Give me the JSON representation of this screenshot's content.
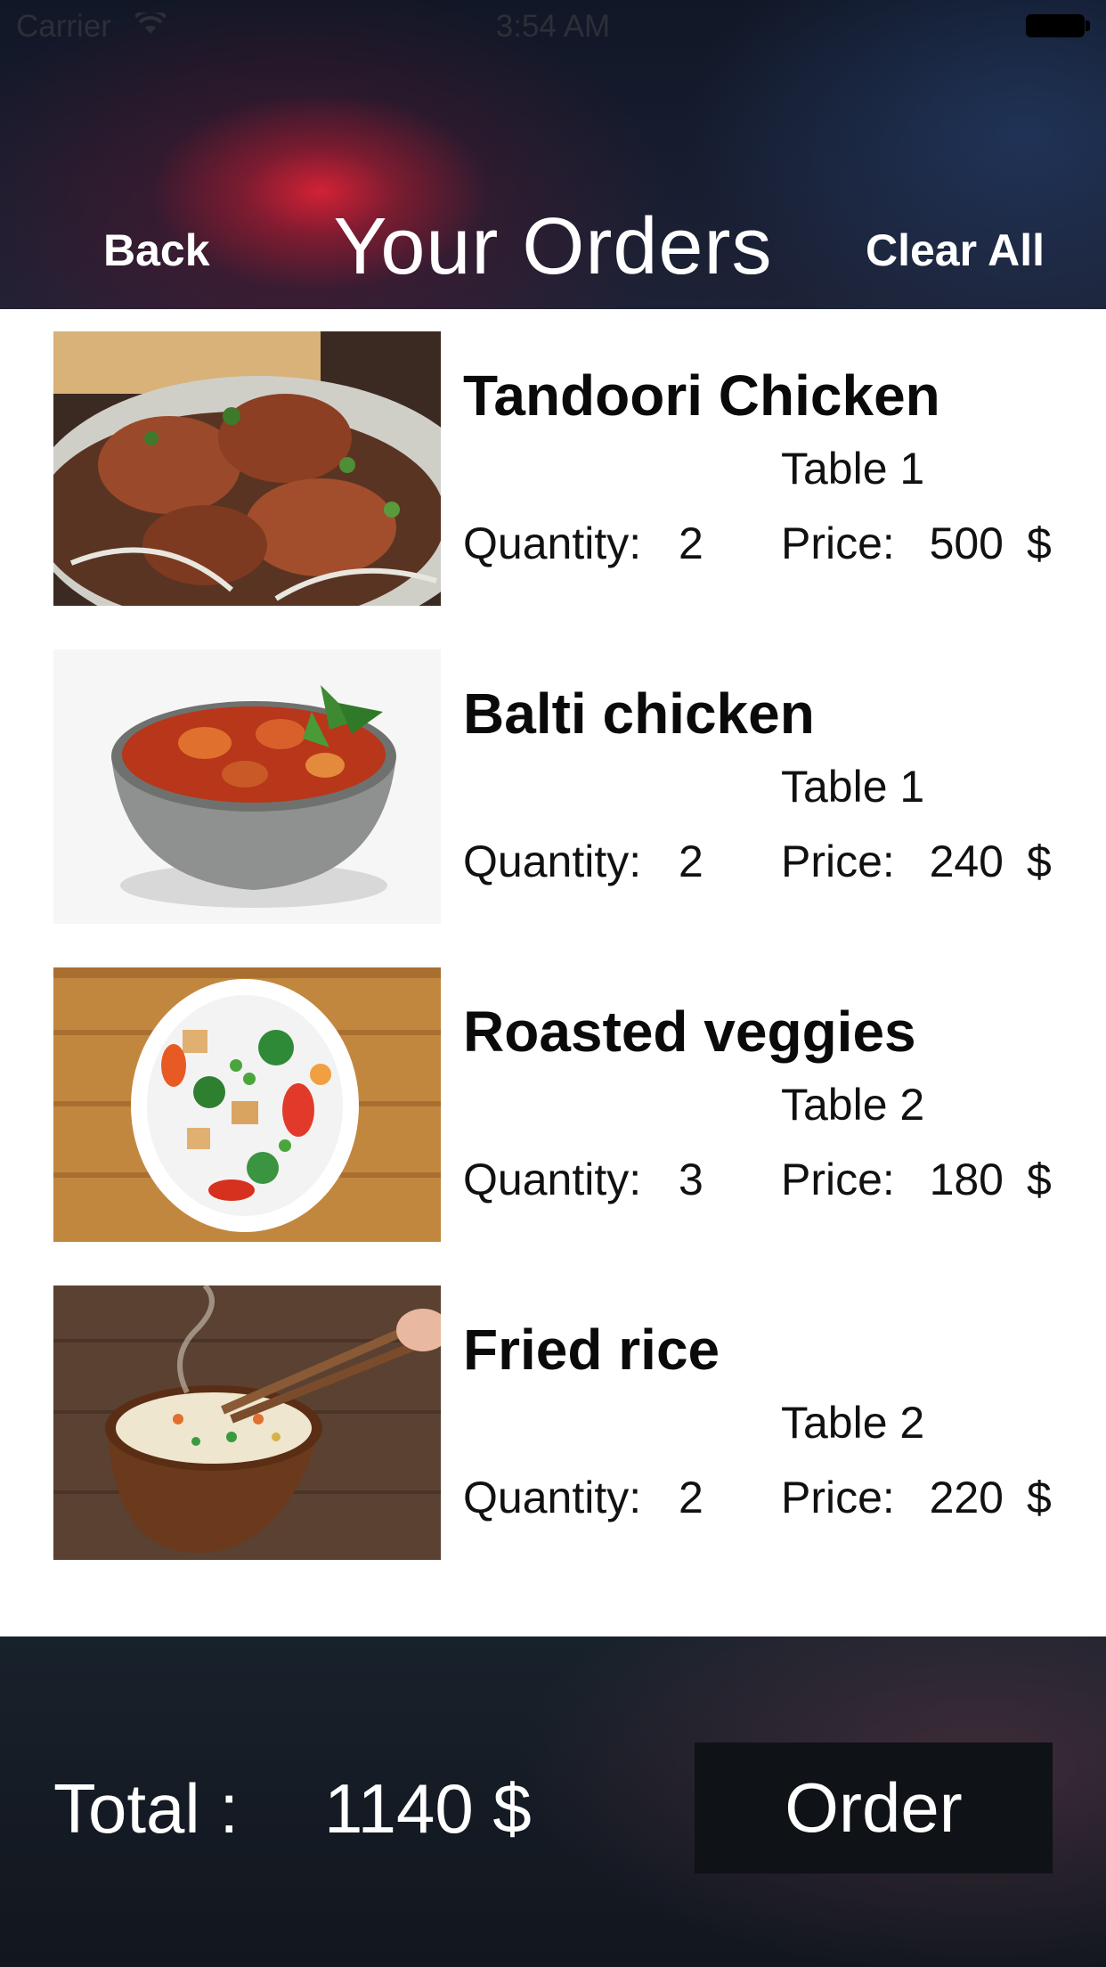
{
  "status_bar": {
    "carrier": "Carrier",
    "time": "3:54 AM"
  },
  "nav": {
    "back_label": "Back",
    "title": "Your Orders",
    "clear_label": "Clear All"
  },
  "orders": [
    {
      "name": "Tandoori Chicken",
      "table": "Table 1",
      "quantity_label": "Quantity:",
      "quantity": "2",
      "price_label": "Price:",
      "price": "500",
      "currency": "$",
      "image": "tandoori-chicken-photo"
    },
    {
      "name": "Balti chicken",
      "table": "Table 1",
      "quantity_label": "Quantity:",
      "quantity": "2",
      "price_label": "Price:",
      "price": "240",
      "currency": "$",
      "image": "balti-chicken-photo"
    },
    {
      "name": "Roasted veggies",
      "table": "Table 2",
      "quantity_label": "Quantity:",
      "quantity": "3",
      "price_label": "Price:",
      "price": "180",
      "currency": "$",
      "image": "roasted-veggies-photo"
    },
    {
      "name": "Fried rice",
      "table": "Table 2",
      "quantity_label": "Quantity:",
      "quantity": "2",
      "price_label": "Price:",
      "price": "220",
      "currency": "$",
      "image": "fried-rice-photo"
    }
  ],
  "footer": {
    "total_label": "Total :",
    "total_value": "1140 $",
    "order_label": "Order"
  },
  "colors": {
    "header_bg": "#161c2e",
    "header_glow": "#e0233a",
    "footer_bg": "#151b24",
    "order_button_bg": "#0f1216",
    "text_dark": "#0a0a0a",
    "text_light": "#ffffff"
  }
}
